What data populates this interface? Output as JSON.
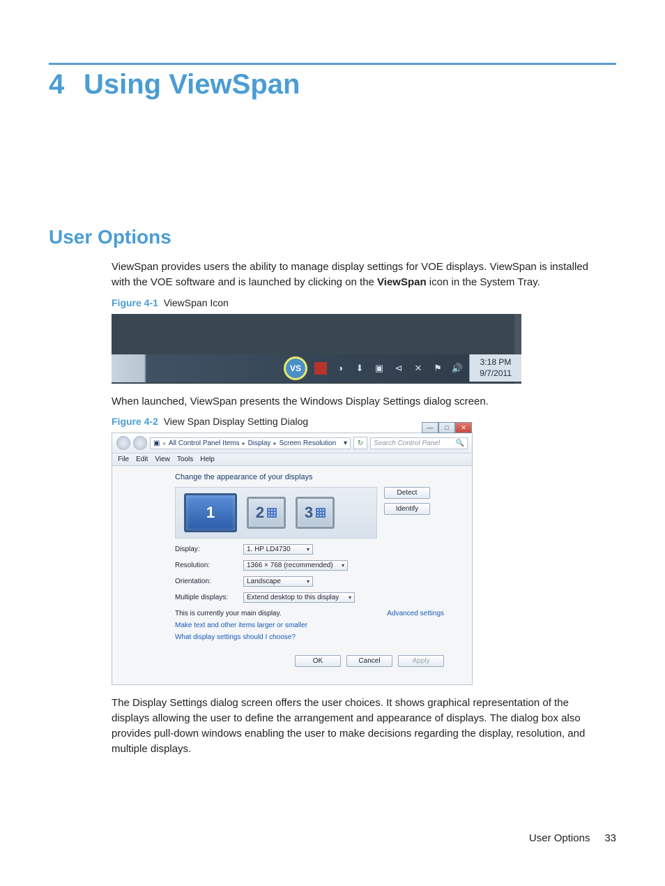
{
  "chapter": {
    "number": "4",
    "title": "Using ViewSpan"
  },
  "section_heading": "User Options",
  "paragraph1_a": "ViewSpan provides users the ability to manage display settings for VOE displays. ViewSpan is installed with the VOE software and is launched by clicking on the ",
  "paragraph1_bold": "ViewSpan",
  "paragraph1_b": " icon in the System Tray.",
  "figure1": {
    "label": "Figure 4-1",
    "title": "ViewSpan Icon"
  },
  "tray": {
    "time": "3:18 PM",
    "date": "9/7/2011",
    "vs_icon_label": "VS"
  },
  "paragraph2": "When launched, ViewSpan presents the Windows Display Settings dialog screen.",
  "figure2": {
    "label": "Figure 4-2",
    "title": "View Span Display Setting Dialog"
  },
  "dialog": {
    "breadcrumb": [
      "All Control Panel Items",
      "Display",
      "Screen Resolution"
    ],
    "search_placeholder": "Search Control Panel",
    "menus": [
      "File",
      "Edit",
      "View",
      "Tools",
      "Help"
    ],
    "heading": "Change the appearance of your displays",
    "detect_btn": "Detect",
    "identify_btn": "Identify",
    "display_numbers": [
      "1",
      "2",
      "3"
    ],
    "fields": {
      "display_label": "Display:",
      "display_value": "1. HP LD4730",
      "resolution_label": "Resolution:",
      "resolution_value": "1366 × 768 (recommended)",
      "orientation_label": "Orientation:",
      "orientation_value": "Landscape",
      "multiple_label": "Multiple displays:",
      "multiple_value": "Extend desktop to this display"
    },
    "main_display_note": "This is currently your main display.",
    "advanced_link": "Advanced settings",
    "link1": "Make text and other items larger or smaller",
    "link2": "What display settings should I choose?",
    "ok_btn": "OK",
    "cancel_btn": "Cancel",
    "apply_btn": "Apply"
  },
  "paragraph3": "The Display Settings dialog screen offers the user choices. It shows graphical representation of the displays allowing the user to define the arrangement and appearance of displays. The dialog box also provides pull-down windows enabling the user to make decisions regarding the display, resolution, and multiple displays.",
  "footer": {
    "section": "User Options",
    "page": "33"
  }
}
